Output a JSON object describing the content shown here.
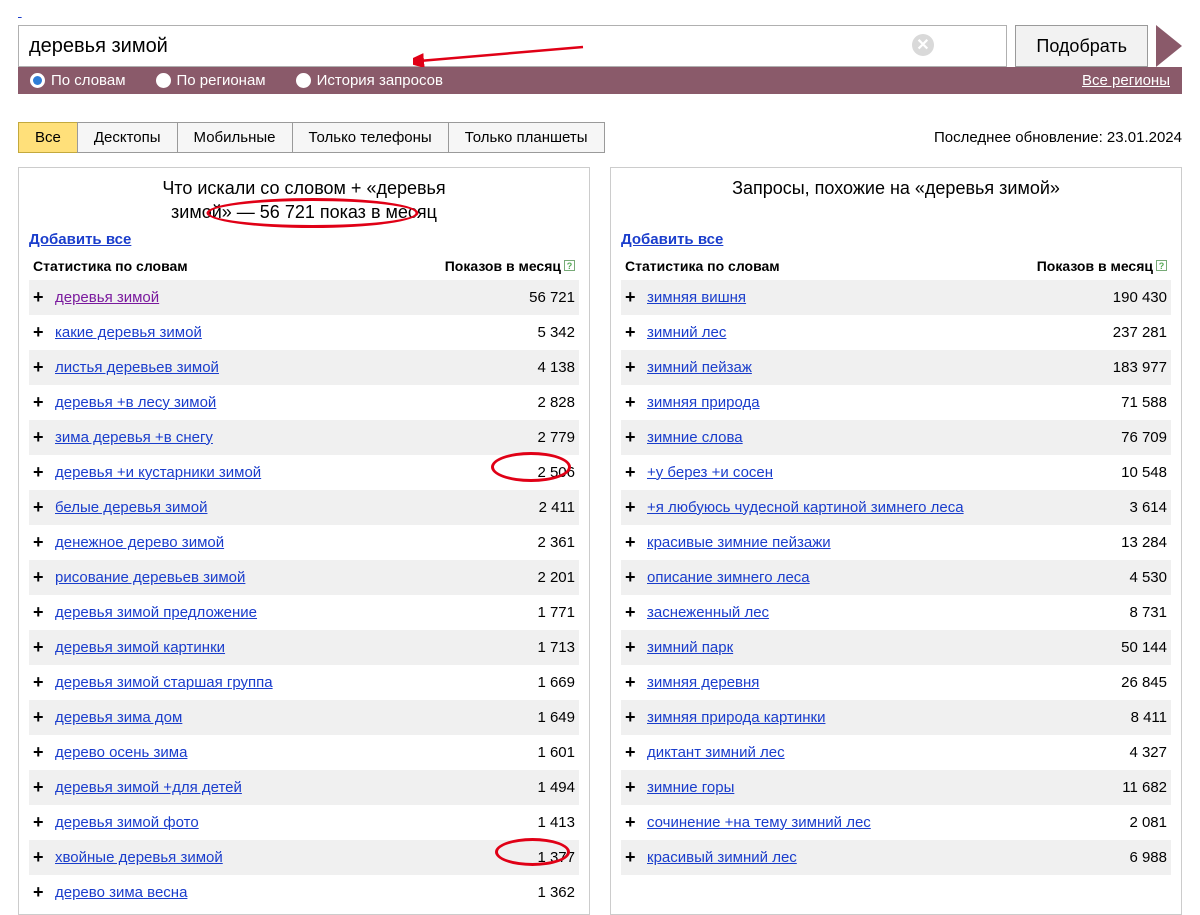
{
  "search": {
    "value": "деревья зимой",
    "submit": "Подобрать",
    "clear_icon": "✕"
  },
  "radios": {
    "by_words": "По словам",
    "by_regions": "По регионам",
    "history": "История запросов",
    "all_regions": "Все регионы"
  },
  "tabs": {
    "all": "Все",
    "desktop": "Десктопы",
    "mobile": "Мобильные",
    "phones": "Только телефоны",
    "tablets": "Только планшеты"
  },
  "last_update_label": "Последнее обновление:",
  "last_update_value": "23.01.2024",
  "left_panel": {
    "title_1": "Что искали со словом + «деревья",
    "title_2": "зимой» — 56 721 показ в месяц",
    "add_all": "Добавить все",
    "col_keyword": "Статистика по словам",
    "col_count": "Показов в месяц",
    "rows": [
      {
        "kw": "деревья зимой",
        "cnt": "56 721",
        "visited": true
      },
      {
        "kw": "какие деревья зимой",
        "cnt": "5 342"
      },
      {
        "kw": "листья деревьев зимой",
        "cnt": "4 138"
      },
      {
        "kw": "деревья +в лесу зимой",
        "cnt": "2 828"
      },
      {
        "kw": "зима деревья +в снегу",
        "cnt": "2 779"
      },
      {
        "kw": "деревья +и кустарники зимой",
        "cnt": "2 506",
        "circle": "a"
      },
      {
        "kw": "белые деревья зимой",
        "cnt": "2 411"
      },
      {
        "kw": "денежное дерево зимой",
        "cnt": "2 361"
      },
      {
        "kw": "рисование деревьев зимой",
        "cnt": "2 201"
      },
      {
        "kw": "деревья зимой предложение",
        "cnt": "1 771"
      },
      {
        "kw": "деревья зимой картинки",
        "cnt": "1 713"
      },
      {
        "kw": "деревья зимой старшая группа",
        "cnt": "1 669"
      },
      {
        "kw": "деревья зима дом",
        "cnt": "1 649"
      },
      {
        "kw": "дерево осень зима",
        "cnt": "1 601"
      },
      {
        "kw": "деревья зимой +для детей",
        "cnt": "1 494"
      },
      {
        "kw": "деревья зимой фото",
        "cnt": "1 413"
      },
      {
        "kw": "хвойные деревья зимой",
        "cnt": "1 377",
        "circle": "b"
      },
      {
        "kw": "дерево зима весна",
        "cnt": "1 362"
      }
    ]
  },
  "right_panel": {
    "title": "Запросы, похожие на «деревья зимой»",
    "add_all": "Добавить все",
    "col_keyword": "Статистика по словам",
    "col_count": "Показов в месяц",
    "rows": [
      {
        "kw": "зимняя вишня",
        "cnt": "190 430"
      },
      {
        "kw": "зимний лес",
        "cnt": "237 281"
      },
      {
        "kw": "зимний пейзаж",
        "cnt": "183 977"
      },
      {
        "kw": "зимняя природа",
        "cnt": "71 588"
      },
      {
        "kw": "зимние слова",
        "cnt": "76 709"
      },
      {
        "kw": "+у берез +и сосен",
        "cnt": "10 548"
      },
      {
        "kw": "+я любуюсь чудесной картиной зимнего леса",
        "cnt": "3 614",
        "long": true
      },
      {
        "kw": "красивые зимние пейзажи",
        "cnt": "13 284"
      },
      {
        "kw": "описание зимнего леса",
        "cnt": "4 530"
      },
      {
        "kw": "заснеженный лес",
        "cnt": "8 731"
      },
      {
        "kw": "зимний парк",
        "cnt": "50 144"
      },
      {
        "kw": "зимняя деревня",
        "cnt": "26 845"
      },
      {
        "kw": "зимняя природа картинки",
        "cnt": "8 411"
      },
      {
        "kw": "диктант зимний лес",
        "cnt": "4 327"
      },
      {
        "kw": "зимние горы",
        "cnt": "11 682"
      },
      {
        "kw": "сочинение +на тему зимний лес",
        "cnt": "2 081"
      },
      {
        "kw": "красивый зимний лес",
        "cnt": "6 988"
      }
    ]
  }
}
